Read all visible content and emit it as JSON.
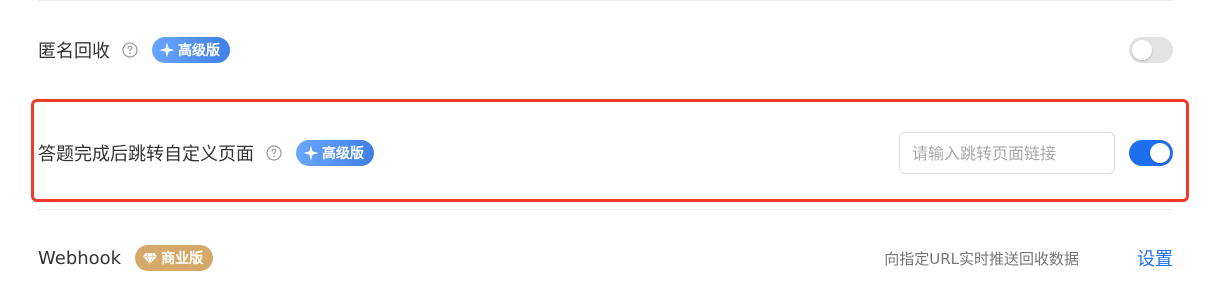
{
  "colors": {
    "accent": "#1e6ff0",
    "pro_badge_start": "#6aa6ff",
    "pro_badge_end": "#3f7fe6",
    "business_badge": "#d4a96a",
    "highlight_border": "#ee3b2b",
    "toggle_off": "#e3e3e3"
  },
  "rows": {
    "anonymous": {
      "label": "匿名回收",
      "help_icon": "question-circle-icon",
      "badge": {
        "label": "高级版",
        "icon": "sparkle-icon"
      },
      "toggle": {
        "state": "off"
      }
    },
    "redirect": {
      "label": "答题完成后跳转自定义页面",
      "help_icon": "question-circle-icon",
      "badge": {
        "label": "高级版",
        "icon": "sparkle-icon"
      },
      "input": {
        "value": "",
        "placeholder": "请输入跳转页面链接"
      },
      "toggle": {
        "state": "on"
      }
    },
    "webhook": {
      "label": "Webhook",
      "badge": {
        "label": "商业版",
        "icon": "diamond-icon"
      },
      "description": "向指定URL实时推送回收数据",
      "action_label": "设置"
    }
  }
}
